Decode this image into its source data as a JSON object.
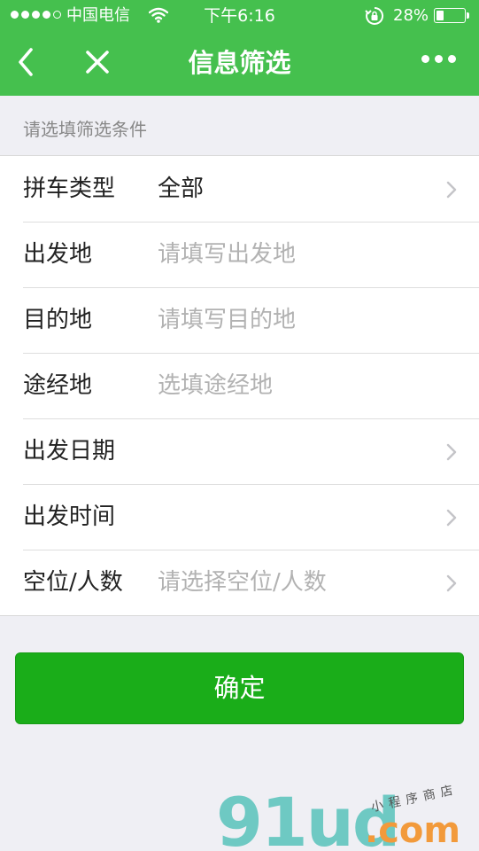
{
  "status_bar": {
    "carrier": "中国电信",
    "time": "下午6:16",
    "battery": "28%",
    "battery_level": 0.28,
    "signal_bars_filled": 4,
    "signal_bars_total": 5
  },
  "nav": {
    "title": "信息筛选",
    "back_icon": "chevron-left-icon",
    "close_icon": "close-icon",
    "more_icon": "more-dots-icon"
  },
  "section_label": "请选填筛选条件",
  "form": {
    "rows": [
      {
        "label": "拼车类型",
        "value": "全部",
        "placeholder": "",
        "has_arrow": true
      },
      {
        "label": "出发地",
        "value": "",
        "placeholder": "请填写出发地",
        "has_arrow": false
      },
      {
        "label": "目的地",
        "value": "",
        "placeholder": "请填写目的地",
        "has_arrow": false
      },
      {
        "label": "途经地",
        "value": "",
        "placeholder": "选填途经地",
        "has_arrow": false
      },
      {
        "label": "出发日期",
        "value": "",
        "placeholder": "",
        "has_arrow": true
      },
      {
        "label": "出发时间",
        "value": "",
        "placeholder": "",
        "has_arrow": true
      },
      {
        "label": "空位/人数",
        "value": "",
        "placeholder": "请选择空位/人数",
        "has_arrow": true
      }
    ]
  },
  "confirm_label": "确定",
  "watermark": {
    "logo": "91ud",
    "suffix": ".com",
    "tagline": "小程序商店"
  },
  "colors": {
    "nav_green": "#45c04e",
    "button_green": "#1aad19",
    "background": "#efeff4",
    "placeholder": "#b2b2b2"
  }
}
